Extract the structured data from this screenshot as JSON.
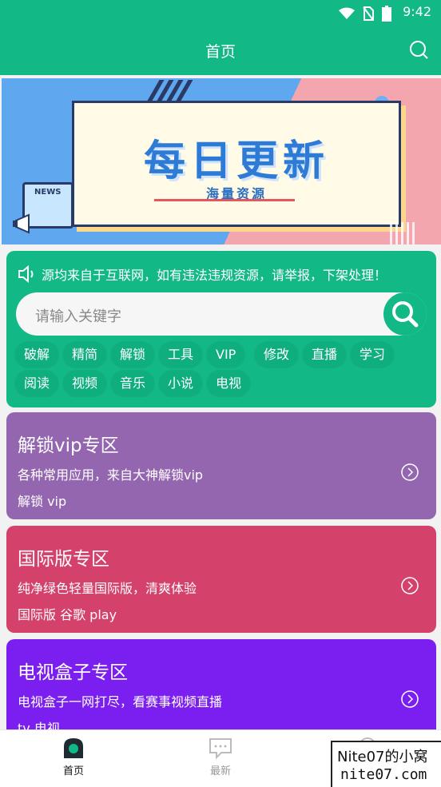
{
  "status_bar": {
    "time": "9:42",
    "icons": [
      "wifi-icon",
      "no-sim-icon",
      "battery-icon"
    ]
  },
  "app_bar": {
    "title": "首页",
    "search_icon": "search-icon"
  },
  "banner": {
    "title": "每日更新",
    "subtitle": "海量资源",
    "badge": "NEWS"
  },
  "notice": {
    "icon": "speaker-icon",
    "text": "源均来自于互联网，如有违法违规资源，请举报，下架处理！"
  },
  "search": {
    "placeholder": "请输入关键字"
  },
  "tags": [
    "破解",
    "精简",
    "解锁",
    "工具",
    "VIP",
    "修改",
    "直播",
    "学习",
    "阅读",
    "视频",
    "音乐",
    "小说",
    "电视"
  ],
  "sections": [
    {
      "title": "解锁vip专区",
      "desc": "各种常用应用，来自大神解锁vip",
      "keywords": "解锁 vip",
      "color": "#9466b0"
    },
    {
      "title": "国际版专区",
      "desc": "纯净绿色轻量国际版，清爽体验",
      "keywords": "国际版 谷歌 play",
      "color": "#d4416a"
    },
    {
      "title": "电视盒子专区",
      "desc": "电视盒子一网打尽，看赛事视频直播",
      "keywords": "tv 电视",
      "color": "#7b1ff0"
    }
  ],
  "bottom_nav": [
    {
      "label": "首页",
      "icon": "home-icon",
      "active": true
    },
    {
      "label": "最新",
      "icon": "message-icon",
      "active": false
    },
    {
      "label": "",
      "icon": "profile-icon",
      "active": false
    }
  ],
  "watermark": {
    "line1": "Nite07的小窝",
    "line2": "nite07.com"
  },
  "colors": {
    "primary": "#12b886"
  }
}
